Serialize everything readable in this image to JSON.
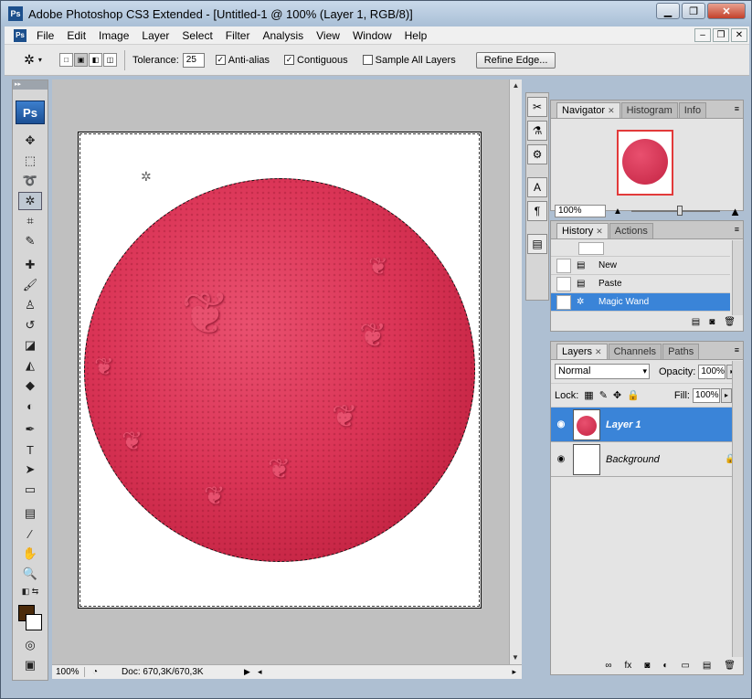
{
  "window": {
    "title": "Adobe Photoshop CS3 Extended - [Untitled-1 @ 100% (Layer 1, RGB/8)]",
    "logo": "Ps"
  },
  "menu": [
    "File",
    "Edit",
    "Image",
    "Layer",
    "Select",
    "Filter",
    "Analysis",
    "View",
    "Window",
    "Help"
  ],
  "options": {
    "tolerance_label": "Tolerance:",
    "tolerance_value": "25",
    "anti_alias_label": "Anti-alias",
    "anti_alias_checked": true,
    "contiguous_label": "Contiguous",
    "contiguous_checked": true,
    "sample_all_label": "Sample All Layers",
    "sample_all_checked": false,
    "refine_edge_label": "Refine Edge..."
  },
  "toolbox": {
    "logo": "Ps",
    "foreground_color": "#4b2a0a",
    "background_color": "#ffffff"
  },
  "status": {
    "zoom": "100%",
    "doc": "Doc: 670,3K/670,3K"
  },
  "navigator": {
    "tabs": [
      "Navigator",
      "Histogram",
      "Info"
    ],
    "zoom": "100%"
  },
  "history": {
    "tabs": [
      "History",
      "Actions"
    ],
    "items": [
      "New",
      "Paste",
      "Magic Wand"
    ],
    "selected": "Magic Wand"
  },
  "layers": {
    "tabs": [
      "Layers",
      "Channels",
      "Paths"
    ],
    "blend_mode": "Normal",
    "opacity_label": "Opacity:",
    "opacity": "100%",
    "lock_label": "Lock:",
    "fill_label": "Fill:",
    "fill": "100%",
    "items": [
      "Layer 1",
      "Background"
    ],
    "selected": "Layer 1"
  }
}
